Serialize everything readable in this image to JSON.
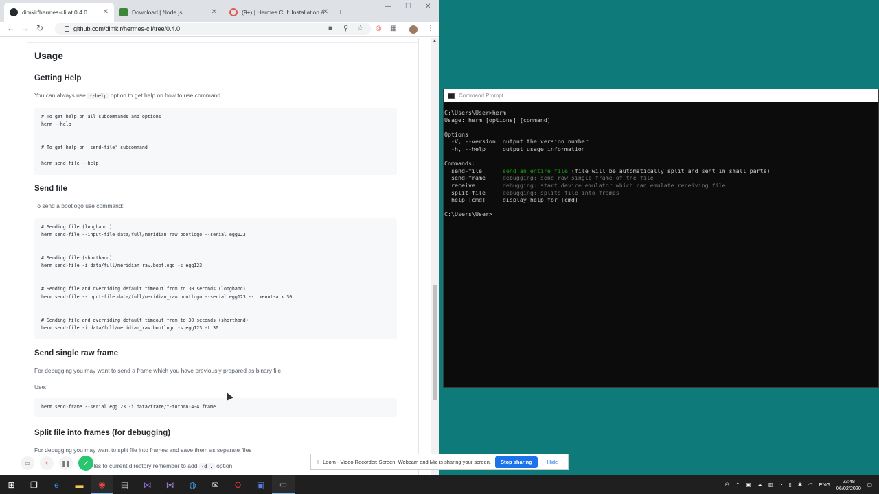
{
  "browser": {
    "tabs": [
      {
        "label": "dimkir/hermes-cli at 0.4.0",
        "icon_color": "#24292e"
      },
      {
        "label": "Download | Node.js",
        "icon_color": "#3c873a"
      },
      {
        "label": "(9+) | Hermes CLI: Installation &",
        "icon_color": "#e2574c"
      }
    ],
    "url": "github.com/dimkir/hermes-cli/tree/0.4.0"
  },
  "readme": {
    "usage_title": "Usage",
    "getting_help": {
      "title": "Getting Help",
      "text_before": "You can always use",
      "code": "--help",
      "text_after": "option to get help on how to use command.",
      "pre": "# To get help on all subcommands and options\nherm --help\n\n\n# To get help on 'send-file' subcommand\n\nherm send-file --help"
    },
    "send_file": {
      "title": "Send file",
      "text": "To send a bootlogo use command:",
      "pre": "# Sending file (longhand )\nherm send-file --input-file data/full/meridian_raw.bootlogo --serial egg123\n\n\n# Sending file (shorthand)\nherm send-file -i data/full/meridian_raw.bootlogo -s egg123\n\n\n# Sending file and overriding default timeout from to 30 seconds (longhand)\nherm send-file --input-file data/full/meridian_raw.bootlogo --serial egg123 --timeout-ack 30\n\n\n# Sending file and overriding default timeout from to 30 seconds (shorthand)\nherm send-file -i data/full/meridian_raw.bootlogo -s egg123 -t 30"
    },
    "send_frame": {
      "title": "Send single raw frame",
      "text": "For debugging you may want to send a frame which you have previously prepared as binary file.",
      "use": "Use:",
      "pre": "herm send-frame --serial egg123 -i data/frame/t-totoro-4-4.frame"
    },
    "split_file": {
      "title": "Split file into frames (for debugging)",
      "text": "For debugging you may want to split file into frames and save them as separate files",
      "text2_before": "ave files to current directory remember to add",
      "code2": "-d .",
      "text2_after": "option"
    }
  },
  "cmd": {
    "title": "Command Prompt",
    "lines": {
      "l1": "C:\\Users\\User>herm",
      "l2": "Usage: herm [options] [command]",
      "l3": "Options:",
      "l4": "  -V, --version  output the version number",
      "l5": "  -h, --help     output usage information",
      "l6": "Commands:",
      "c1_name": "  send-file      ",
      "c1_desc": "send an entire file",
      "c1_rest": " (file will be automatically split and sent in small parts)",
      "c2_name": "  send-frame     ",
      "c2_desc": "debugging: send raw single frame of the file",
      "c3_name": "  receive        ",
      "c3_desc": "debugging: start device emulator which can emulate receiving file",
      "c4_name": "  split-file     ",
      "c4_desc": "debugging: splits file into frames",
      "c5": "  help [cmd]     display help for [cmd]",
      "prompt": "C:\\Users\\User>"
    }
  },
  "loom": {
    "banner_text": "Loom - Video Recorder: Screen, Webcam and Mic is sharing your screen.",
    "stop_label": "Stop sharing",
    "hide_label": "Hide"
  },
  "taskbar": {
    "lang": "ENG",
    "time": "23:48",
    "date": "06/02/2020"
  }
}
